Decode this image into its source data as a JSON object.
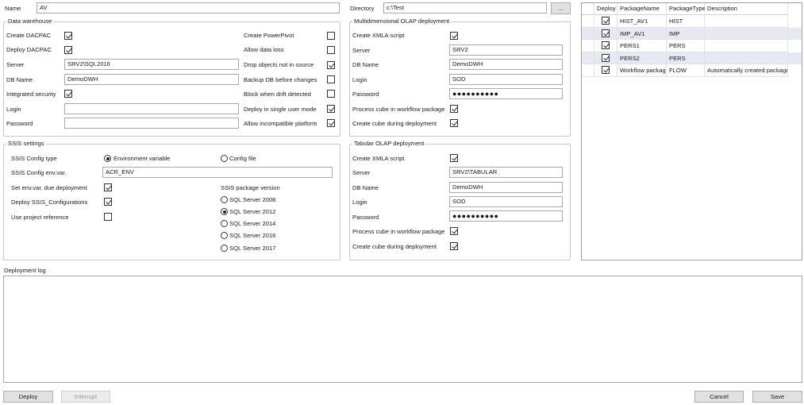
{
  "top": {
    "name_label": "Name",
    "name_value": "AV",
    "directory_label": "Directory",
    "directory_value": "c:\\Test",
    "browse_label": "..."
  },
  "data_warehouse": {
    "title": "Data warehouse",
    "create_dacpac": {
      "label": "Create DACPAC",
      "checked": true
    },
    "deploy_dacpac": {
      "label": "Deploy DACPAC",
      "checked": true
    },
    "server_label": "Server",
    "server_value": "SRV2\\SQL2016",
    "dbname_label": "DB Name",
    "dbname_value": "DemoDWH",
    "integrated_security": {
      "label": "Integrated security",
      "checked": true
    },
    "login_label": "Login",
    "login_value": "",
    "password_label": "Password",
    "password_value": "",
    "create_powerpivot": {
      "label": "Create PowerPivot",
      "checked": false
    },
    "allow_data_loss": {
      "label": "Allow data loss",
      "checked": false
    },
    "drop_objects": {
      "label": "Drop objects not in source",
      "checked": true
    },
    "backup_db": {
      "label": "Backup DB before changes",
      "checked": false
    },
    "block_drift": {
      "label": "Block when drift detected",
      "checked": false
    },
    "single_user": {
      "label": "Deploy in single user mode",
      "checked": true
    },
    "incompatible_platform": {
      "label": "Allow incompatible platform",
      "checked": true
    }
  },
  "ssis": {
    "title": "SSIS settings",
    "config_type_label": "SSIS Config type",
    "env_var_option": {
      "label": "Environment variable",
      "selected": true
    },
    "config_file_option": {
      "label": "Config file",
      "selected": false
    },
    "env_var_label": "SSIS Config env.var.",
    "env_var_value": "ACR_ENV",
    "set_env_var": {
      "label": "Set env.var. due deployment",
      "checked": true
    },
    "deploy_configs": {
      "label": "Deploy SSIS_Configurations",
      "checked": true
    },
    "project_ref": {
      "label": "Use project reference",
      "checked": false
    },
    "version_label": "SSIS package version",
    "versions": [
      {
        "label": "SQL Server 2008",
        "selected": false
      },
      {
        "label": "SQL Server 2012",
        "selected": true
      },
      {
        "label": "SQL Server 2014",
        "selected": false
      },
      {
        "label": "SQL Server 2016",
        "selected": false
      },
      {
        "label": "SQL Server 2017",
        "selected": false
      }
    ]
  },
  "multidim": {
    "title": "Multidimensional OLAP deployment",
    "create_xmla": {
      "label": "Create XMLA script",
      "checked": true
    },
    "server_label": "Server",
    "server_value": "SRV2",
    "dbname_label": "DB Name",
    "dbname_value": "DemoDWH",
    "login_label": "Login",
    "login_value": "SOD",
    "password_label": "Password",
    "password_value": "●●●●●●●●●●",
    "process_cube": {
      "label": "Process cube in workflow package",
      "checked": true
    },
    "create_cube": {
      "label": "Create cube during deployment",
      "checked": true
    }
  },
  "tabular": {
    "title": "Tabular OLAP deployment",
    "create_xmla": {
      "label": "Create XMLA script",
      "checked": true
    },
    "server_label": "Server",
    "server_value": "SRV2\\TABULAR",
    "dbname_label": "DB Name",
    "dbname_value": "DemoDWH",
    "login_label": "Login",
    "login_value": "SOD",
    "password_label": "Password",
    "password_value": "●●●●●●●●●●",
    "process_cube": {
      "label": "Process cube in workflow package",
      "checked": true
    },
    "create_cube": {
      "label": "Create cube during deployment",
      "checked": true
    }
  },
  "packages": {
    "columns": [
      "Deploy",
      "PackageName",
      "PackageType",
      "Description"
    ],
    "rows": [
      {
        "deploy": true,
        "name": "HIST_AV1",
        "type": "HIST",
        "description": ""
      },
      {
        "deploy": true,
        "name": "IMP_AV1",
        "type": "IMP",
        "description": ""
      },
      {
        "deploy": true,
        "name": "PERS1",
        "type": "PERS",
        "description": ""
      },
      {
        "deploy": true,
        "name": "PERS2",
        "type": "PERS",
        "description": ""
      },
      {
        "deploy": true,
        "name": "Workflow package",
        "type": "FLOW",
        "description": "Automatically created package"
      }
    ]
  },
  "log": {
    "label": "Deployment log",
    "content": ""
  },
  "buttons": {
    "deploy": "Deploy",
    "interrupt": "Interrupt",
    "cancel": "Cancel",
    "save": "Save"
  },
  "colors": {
    "row_alt": "#e6e9f4",
    "group_border": "#c8c8c8",
    "button_face": "#e1e1e1"
  }
}
